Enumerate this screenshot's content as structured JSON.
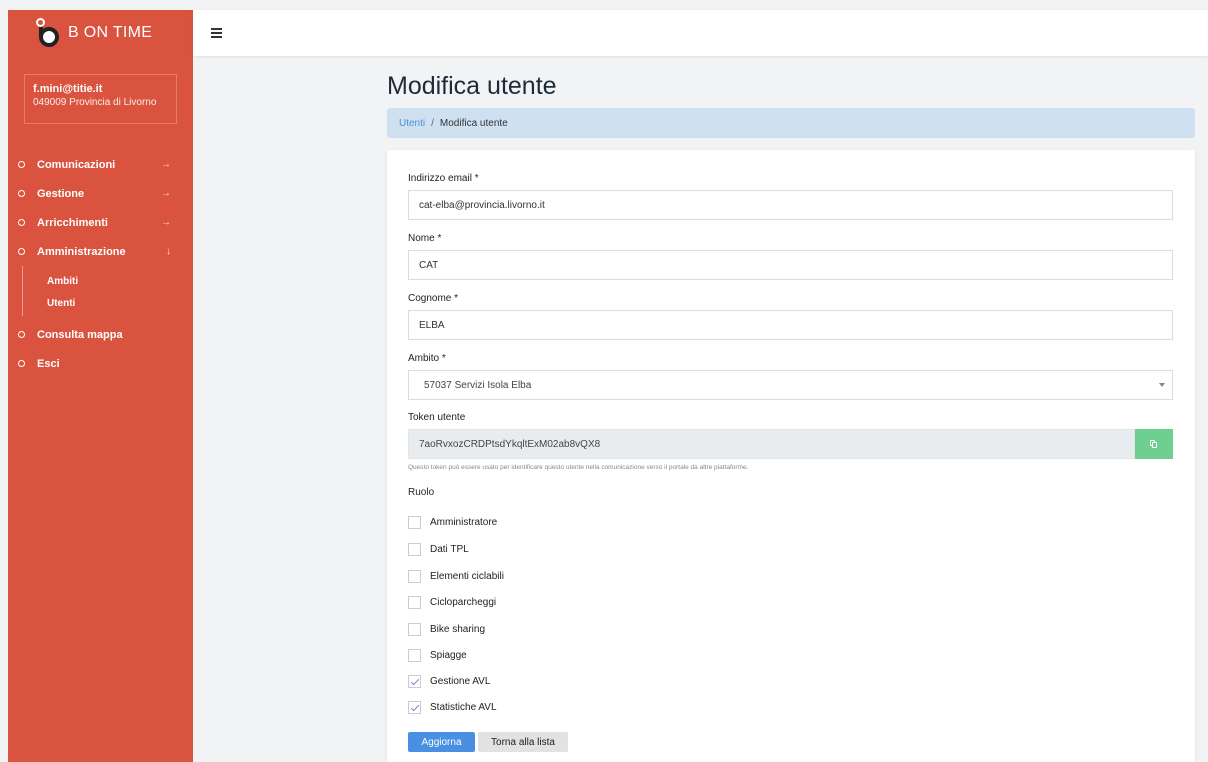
{
  "brand": {
    "name": "B ON TIME"
  },
  "user": {
    "email": "f.mini@titie.it",
    "org": "049009 Provincia di Livorno"
  },
  "menu": {
    "items": [
      {
        "label": "Comunicazioni",
        "arrow": "→"
      },
      {
        "label": "Gestione",
        "arrow": "→"
      },
      {
        "label": "Arricchimenti",
        "arrow": "→"
      },
      {
        "label": "Amministrazione",
        "arrow": "↓"
      }
    ],
    "submenu": [
      {
        "label": "Ambiti"
      },
      {
        "label": "Utenti"
      }
    ],
    "after": [
      {
        "label": "Consulta mappa"
      },
      {
        "label": "Esci"
      }
    ]
  },
  "page": {
    "title": "Modifica utente"
  },
  "breadcrumb": {
    "link": "Utenti",
    "separator": "/",
    "current": "Modifica utente"
  },
  "form": {
    "email": {
      "label": "Indirizzo email *",
      "value": "cat-elba@provincia.livorno.it"
    },
    "nome": {
      "label": "Nome *",
      "value": "CAT"
    },
    "cognome": {
      "label": "Cognome *",
      "value": "ELBA"
    },
    "ambito": {
      "label": "Ambito *",
      "value": "57037 Servizi Isola Elba"
    },
    "token": {
      "label": "Token utente",
      "value": "7aoRvxozCRDPtsdYkqltExM02ab8vQX8",
      "help": "Questo token può essere usato per identificare questo utente nella comunicazione verso il portale da altre piattaforme."
    },
    "ruolo": {
      "label": "Ruolo",
      "options": [
        {
          "label": "Amministratore",
          "checked": false
        },
        {
          "label": "Dati TPL",
          "checked": false
        },
        {
          "label": "Elementi ciclabili",
          "checked": false
        },
        {
          "label": "Cicloparcheggi",
          "checked": false
        },
        {
          "label": "Bike sharing",
          "checked": false
        },
        {
          "label": "Spiagge",
          "checked": false
        },
        {
          "label": "Gestione AVL",
          "checked": true
        },
        {
          "label": "Statistiche AVL",
          "checked": true
        }
      ]
    },
    "buttons": {
      "submit": "Aggiorna",
      "back": "Torna alla lista"
    }
  },
  "colors": {
    "sidebar": "#d9533f",
    "primary": "#4a90e2",
    "copy": "#6fcf91",
    "breadcrumb_bg": "#cfe0f1"
  }
}
